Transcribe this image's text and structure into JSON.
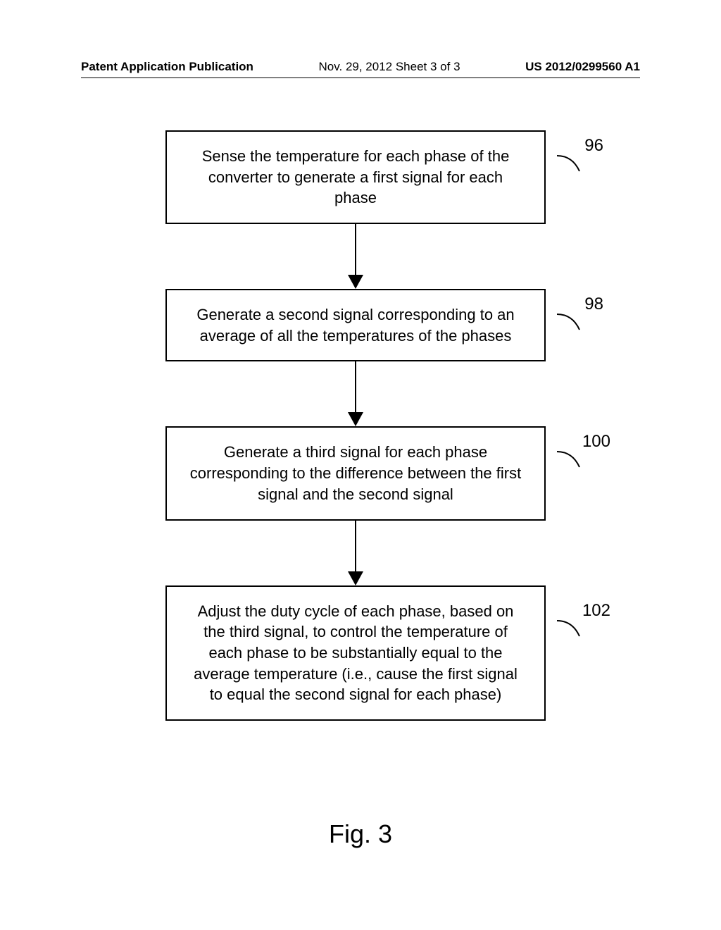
{
  "header": {
    "left": "Patent Application Publication",
    "center": "Nov. 29, 2012  Sheet 3 of 3",
    "right": "US 2012/0299560 A1"
  },
  "steps": [
    {
      "ref": "96",
      "text": "Sense the temperature for each phase of the converter to generate a first signal for each phase"
    },
    {
      "ref": "98",
      "text": "Generate a second signal corresponding to an average of all the temperatures of the phases"
    },
    {
      "ref": "100",
      "text": "Generate a third signal for each phase corresponding to the difference between the first signal and the second signal"
    },
    {
      "ref": "102",
      "text": "Adjust the duty cycle of each phase, based on the third signal, to control the temperature of each phase to be substantially equal to the average temperature (i.e., cause the first signal to equal the second signal for each phase)"
    }
  ],
  "figure_label": "Fig. 3"
}
